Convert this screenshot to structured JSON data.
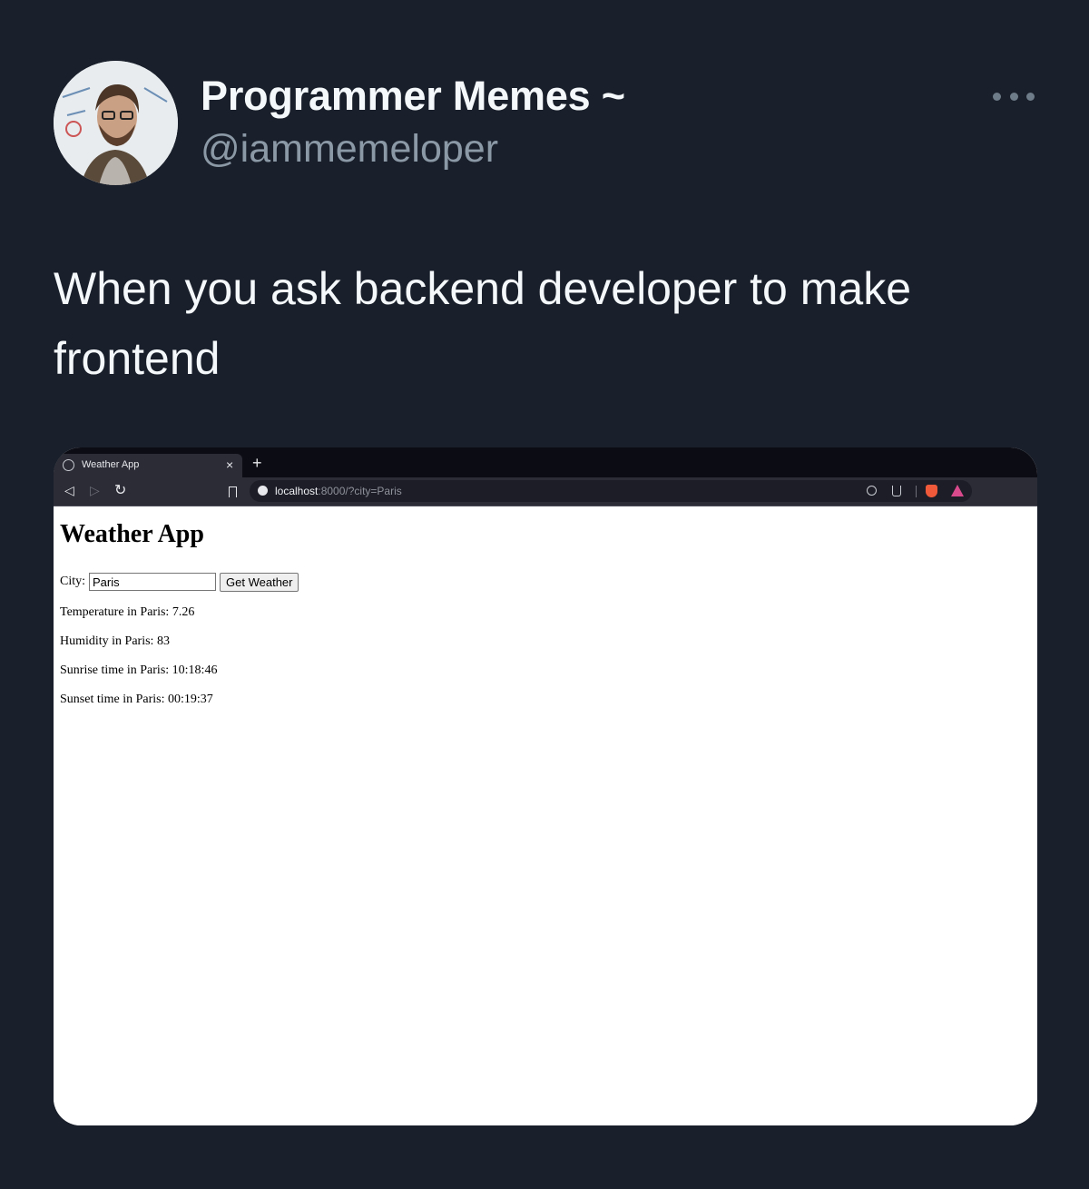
{
  "tweet": {
    "display_name": "Programmer Memes ~",
    "handle": "@iammemeloper",
    "text": "When you ask backend developer to make frontend"
  },
  "browser": {
    "tab_title": "Weather App",
    "close_symbol": "×",
    "new_tab_symbol": "+",
    "url_host": "localhost",
    "url_rest": ":8000/?city=Paris"
  },
  "weather_page": {
    "heading": "Weather App",
    "city_label": "City:",
    "city_value": "Paris",
    "button_label": "Get Weather",
    "results": [
      "Temperature in Paris: 7.26",
      "Humidity in Paris: 83",
      "Sunrise time in Paris: 10:18:46",
      "Sunset time in Paris: 00:19:37"
    ]
  }
}
